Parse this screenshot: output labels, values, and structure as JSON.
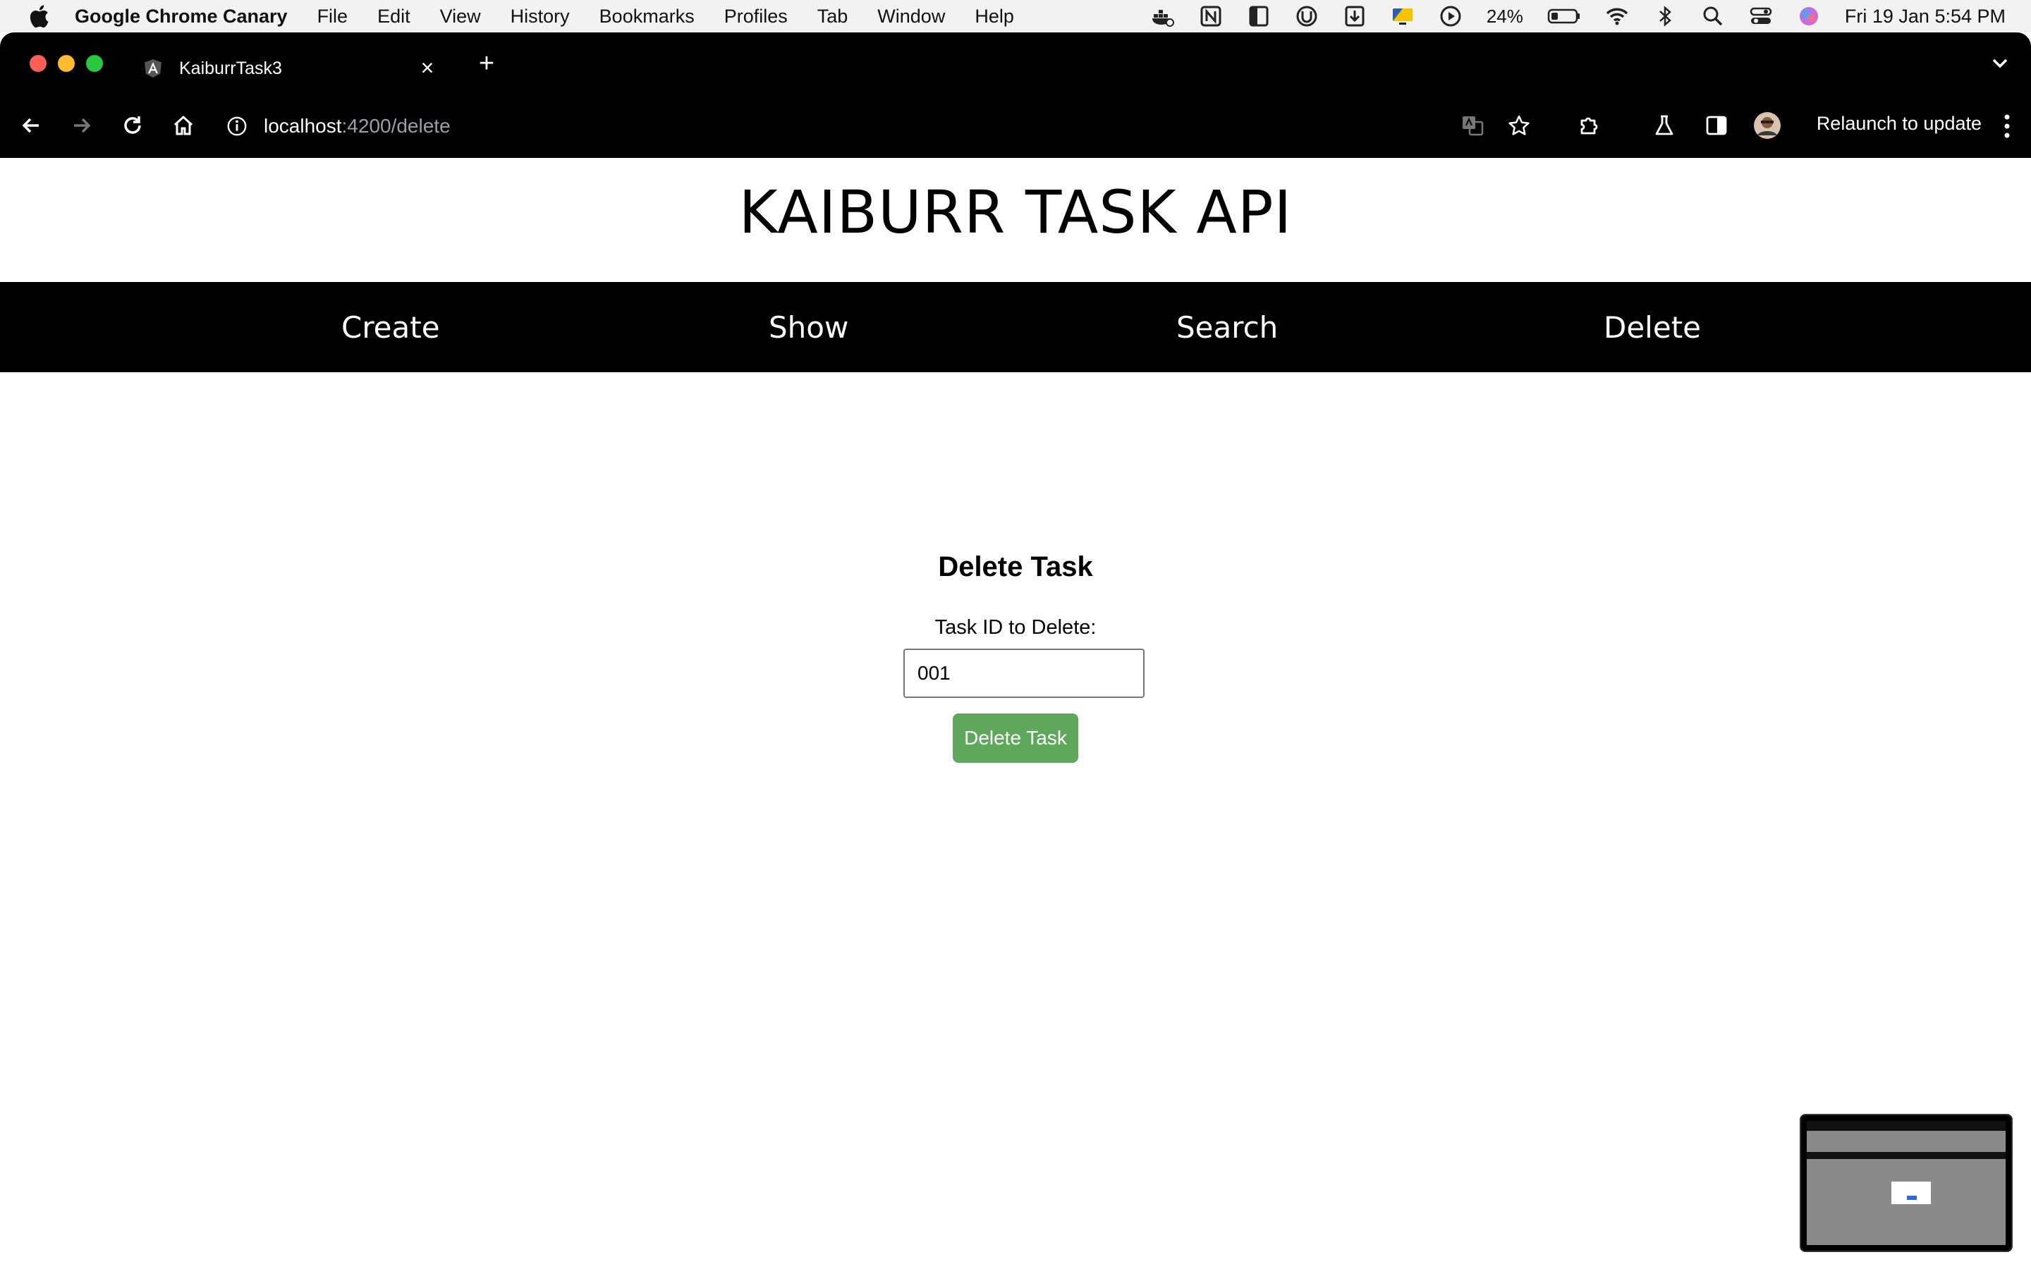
{
  "menubar": {
    "app_name": "Google Chrome Canary",
    "items": [
      "File",
      "Edit",
      "View",
      "History",
      "Bookmarks",
      "Profiles",
      "Tab",
      "Window",
      "Help"
    ],
    "battery_percent": "24%",
    "datetime": "Fri 19 Jan  5:54 PM"
  },
  "browser": {
    "tab_title": "KaiburrTask3",
    "url_host": "localhost",
    "url_path": ":4200/delete",
    "relaunch_label": "Relaunch to update"
  },
  "page": {
    "title": "KAIBURR TASK API",
    "nav": [
      "Create",
      "Show",
      "Search",
      "Delete"
    ],
    "form": {
      "heading": "Delete Task",
      "label": "Task ID to Delete:",
      "input_value": "001",
      "button_label": "Delete Task"
    }
  },
  "colors": {
    "button": "#5fa85b",
    "navbar": "#000000",
    "chrome": "#000000"
  }
}
